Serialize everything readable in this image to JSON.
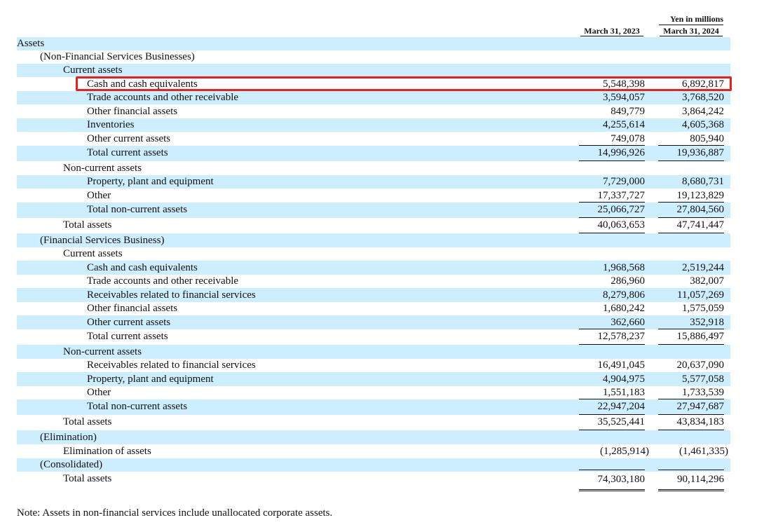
{
  "header": {
    "unit": "Yen in millions",
    "col1": "March 31, 2023",
    "col2": "March 31, 2024"
  },
  "rows": [
    {
      "label": "Assets",
      "indent": 0,
      "shaded": true,
      "h": 19
    },
    {
      "label": "(Non-Financial Services Businesses)",
      "indent": 1,
      "shaded": false,
      "h": 19
    },
    {
      "label": "Current assets",
      "indent": 2,
      "shaded": true,
      "h": 19
    },
    {
      "label": "Cash and cash equivalents",
      "indent": 3,
      "shaded": false,
      "h": 20,
      "v1": "5,548,398",
      "v2": "6,892,817",
      "highlighted": true
    },
    {
      "label": "Trade accounts and other receivable",
      "indent": 3,
      "shaded": true,
      "h": 19,
      "v1": "3,594,057",
      "v2": "3,768,520"
    },
    {
      "label": "Other financial assets",
      "indent": 3,
      "shaded": false,
      "h": 20,
      "v1": "849,779",
      "v2": "3,864,242"
    },
    {
      "label": "Inventories",
      "indent": 3,
      "shaded": true,
      "h": 19,
      "v1": "4,255,614",
      "v2": "4,605,368"
    },
    {
      "label": "Other current assets",
      "indent": 3,
      "shaded": false,
      "h": 20,
      "v1": "749,078",
      "v2": "805,940",
      "rule": "bottom"
    },
    {
      "label": "Total current assets",
      "indent": 3,
      "shaded": true,
      "h": 22,
      "v1": "14,996,926",
      "v2": "19,936,887",
      "rule": "bottom"
    },
    {
      "label": "Non-current assets",
      "indent": 2,
      "shaded": false,
      "h": 20
    },
    {
      "label": "Property, plant and equipment",
      "indent": 3,
      "shaded": true,
      "h": 19,
      "v1": "7,729,000",
      "v2": "8,680,731"
    },
    {
      "label": "Other",
      "indent": 3,
      "shaded": false,
      "h": 20,
      "v1": "17,337,727",
      "v2": "19,123,829",
      "rule": "bottom"
    },
    {
      "label": "Total non-current assets",
      "indent": 3,
      "shaded": true,
      "h": 22,
      "v1": "25,066,727",
      "v2": "27,804,560",
      "rule": "bottom"
    },
    {
      "label": "Total assets",
      "indent": 2,
      "shaded": false,
      "h": 22,
      "v1": "40,063,653",
      "v2": "47,741,447",
      "rule": "bottom"
    },
    {
      "label": "(Financial Services Business)",
      "indent": 1,
      "shaded": true,
      "h": 20
    },
    {
      "label": "Current assets",
      "indent": 2,
      "shaded": false,
      "h": 19
    },
    {
      "label": "Cash and cash equivalents",
      "indent": 3,
      "shaded": true,
      "h": 20,
      "v1": "1,968,568",
      "v2": "2,519,244"
    },
    {
      "label": "Trade accounts and other receivable",
      "indent": 3,
      "shaded": false,
      "h": 19,
      "v1": "286,960",
      "v2": "382,007"
    },
    {
      "label": "Receivables related to financial services",
      "indent": 3,
      "shaded": true,
      "h": 20,
      "v1": "8,279,806",
      "v2": "11,057,269"
    },
    {
      "label": "Other financial assets",
      "indent": 3,
      "shaded": false,
      "h": 19,
      "v1": "1,680,242",
      "v2": "1,575,059"
    },
    {
      "label": "Other current assets",
      "indent": 3,
      "shaded": true,
      "h": 20,
      "v1": "362,660",
      "v2": "352,918",
      "rule": "bottom"
    },
    {
      "label": "Total current assets",
      "indent": 3,
      "shaded": false,
      "h": 22,
      "v1": "12,578,237",
      "v2": "15,886,497",
      "rule": "bottom"
    },
    {
      "label": "Non-current assets",
      "indent": 2,
      "shaded": true,
      "h": 20
    },
    {
      "label": "Receivables related to financial services",
      "indent": 3,
      "shaded": false,
      "h": 19,
      "v1": "16,491,045",
      "v2": "20,637,090"
    },
    {
      "label": "Property, plant and equipment",
      "indent": 3,
      "shaded": true,
      "h": 20,
      "v1": "4,904,975",
      "v2": "5,577,058"
    },
    {
      "label": "Other",
      "indent": 3,
      "shaded": false,
      "h": 19,
      "v1": "1,551,183",
      "v2": "1,733,539",
      "rule": "bottom"
    },
    {
      "label": "Total non-current assets",
      "indent": 3,
      "shaded": true,
      "h": 22,
      "v1": "22,947,204",
      "v2": "27,947,687",
      "rule": "bottom"
    },
    {
      "label": "Total assets",
      "indent": 2,
      "shaded": false,
      "h": 22,
      "v1": "35,525,441",
      "v2": "43,834,183",
      "rule": "bottom"
    },
    {
      "label": "(Elimination)",
      "indent": 1,
      "shaded": true,
      "h": 20
    },
    {
      "label": "Elimination of assets",
      "indent": 2,
      "shaded": false,
      "h": 20,
      "v1": "(1,285,914)",
      "v2": "(1,461,335)",
      "neg": true
    },
    {
      "label": "(Consolidated)",
      "indent": 1,
      "shaded": true,
      "h": 19
    },
    {
      "label": "Total assets",
      "indent": 2,
      "shaded": false,
      "h": 28,
      "v1": "74,303,180",
      "v2": "90,114,296",
      "rule": "double"
    }
  ],
  "note": "Note: Assets in non-financial services include unallocated corporate assets."
}
